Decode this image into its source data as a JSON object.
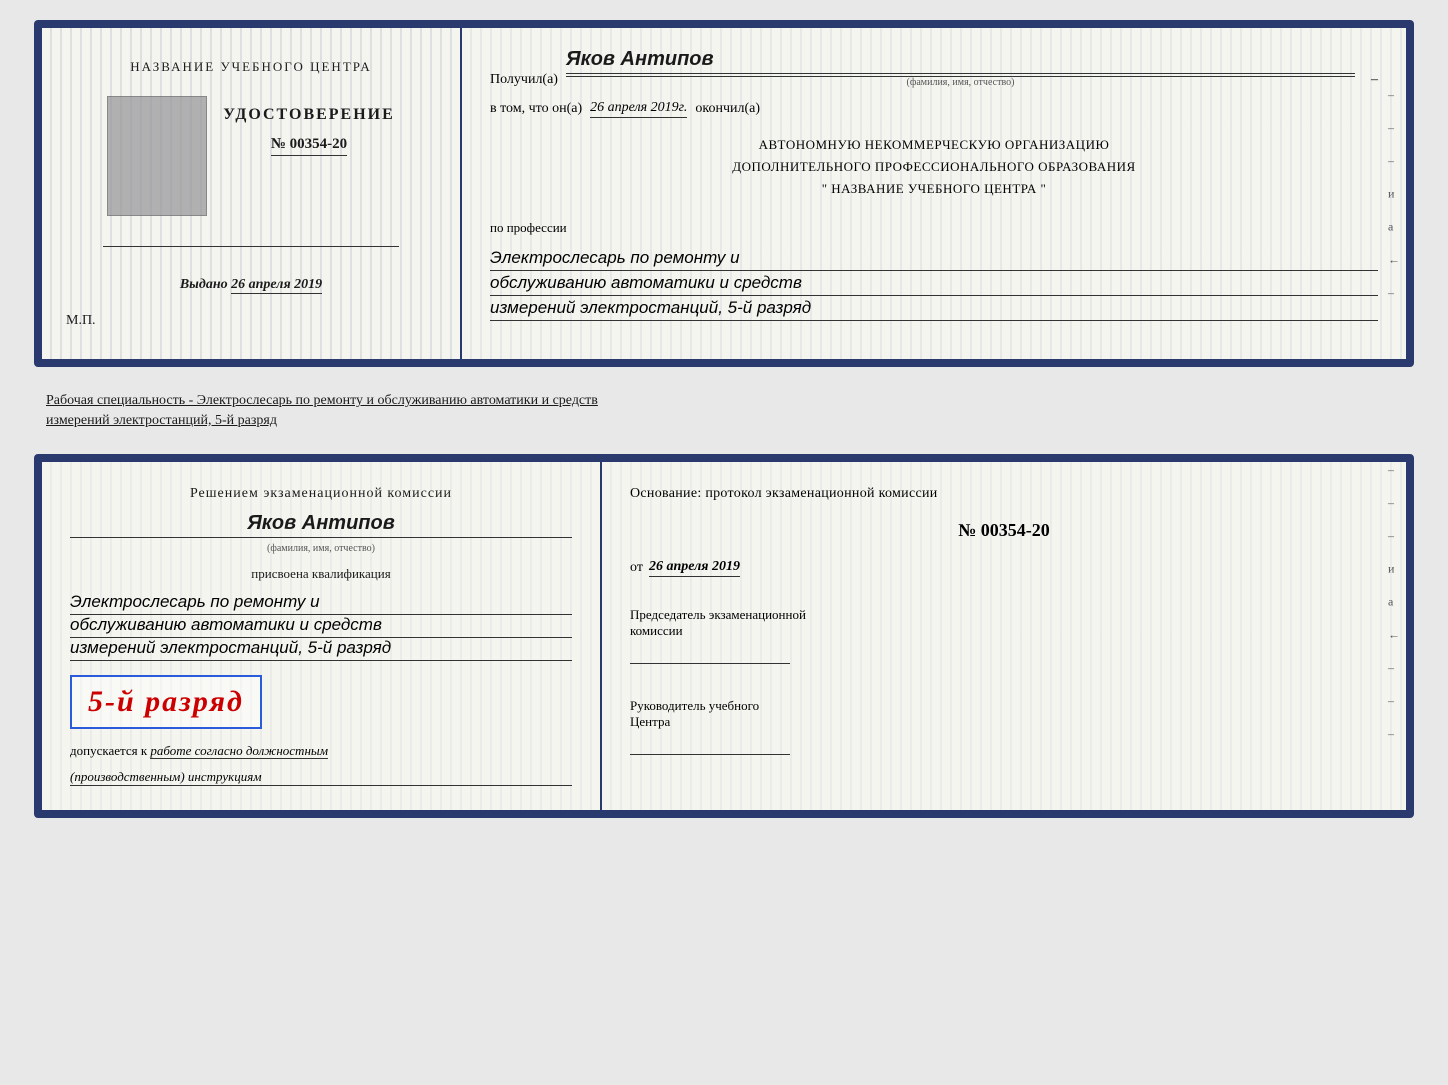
{
  "top_document": {
    "left": {
      "institution_name": "НАЗВАНИЕ УЧЕБНОГО ЦЕНТРА",
      "udostoverenie_label": "УДОСТОВЕРЕНИЕ",
      "doc_number": "№ 00354-20",
      "vydano_label": "Выдано",
      "vydano_date": "26 апреля 2019",
      "mp_label": "М.П."
    },
    "right": {
      "poluchil_prefix": "Получил(а)",
      "recipient_name": "Яков Антипов",
      "fio_hint": "(фамилия, имя, отчество)",
      "vtom_prefix": "в том, что он(а)",
      "completion_date": "26 апреля 2019г.",
      "okončil": "окончил(а)",
      "org_line1": "АВТОНОМНУЮ НЕКОММЕРЧЕСКУЮ ОРГАНИЗАЦИЮ",
      "org_line2": "ДОПОЛНИТЕЛЬНОГО ПРОФЕССИОНАЛЬНОГО ОБРАЗОВАНИЯ",
      "org_line3": "\"  НАЗВАНИЕ УЧЕБНОГО ЦЕНТРА  \"",
      "po_professii": "по профессии",
      "qualification_line1": "Электрослесарь по ремонту и",
      "qualification_line2": "обслуживанию автоматики и средств",
      "qualification_line3": "измерений электростанций, 5-й разряд",
      "right_marks": [
        "–",
        "–",
        "–",
        "и",
        "а",
        "←",
        "–"
      ]
    }
  },
  "separator": {
    "text": "Рабочая специальность - Электрослесарь по ремонту и обслуживанию автоматики и средств",
    "text2": "измерений электростанций, 5-й разряд"
  },
  "bottom_document": {
    "left": {
      "komissia_header": "Решением  экзаменационной  комиссии",
      "komissia_name": "Яков Антипов",
      "fio_hint": "(фамилия, имя, отчество)",
      "prisvoena": "присвоена квалификация",
      "qualification_line1": "Электрослесарь по ремонту и",
      "qualification_line2": "обслуживанию автоматики и средств",
      "qualification_line3": "измерений электростанций, 5-й разряд",
      "razryad_text": "5-й разряд",
      "dopuskaetsya_prefix": "допускается к",
      "dopuskaetsya_text": "работе согласно должностным",
      "dopuskaetsya_text2": "(производственным) инструкциям"
    },
    "right": {
      "osnovanie_label": "Основание: протокол экзаменационной  комиссии",
      "protocol_number": "№  00354-20",
      "ot_prefix": "от",
      "protocol_date": "26 апреля 2019",
      "chairman_title": "Председатель экзаменационной",
      "chairman_subtitle": "комиссии",
      "rukovoditel_title": "Руководитель учебного",
      "rukovoditel_subtitle": "Центра",
      "right_marks": [
        "–",
        "–",
        "–",
        "и",
        "а",
        "←",
        "–",
        "–",
        "–"
      ]
    }
  }
}
